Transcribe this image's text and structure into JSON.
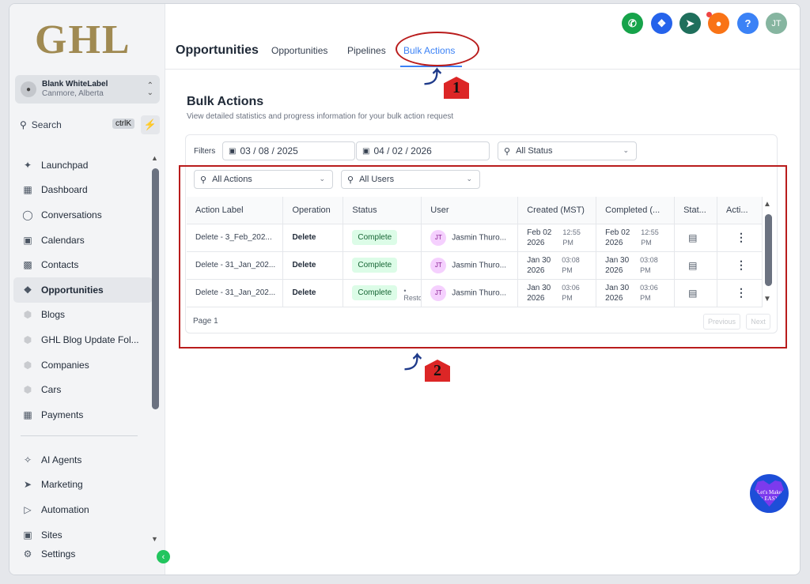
{
  "brand": {
    "logo_text": "GHL"
  },
  "account": {
    "name": "Blank WhiteLabel",
    "location": "Canmore, Alberta"
  },
  "search": {
    "placeholder": "Search",
    "shortcut": "ctrlK"
  },
  "sidebar": {
    "items": [
      {
        "label": "Launchpad",
        "icon": "rocket-icon"
      },
      {
        "label": "Dashboard",
        "icon": "dashboard-icon"
      },
      {
        "label": "Conversations",
        "icon": "chat-icon"
      },
      {
        "label": "Calendars",
        "icon": "calendar-icon"
      },
      {
        "label": "Contacts",
        "icon": "contacts-icon"
      },
      {
        "label": "Opportunities",
        "icon": "opportunities-icon",
        "active": true
      },
      {
        "label": "Blogs",
        "icon": "cube-icon"
      },
      {
        "label": "GHL Blog Update Fol...",
        "icon": "cube-icon"
      },
      {
        "label": "Companies",
        "icon": "cube-icon"
      },
      {
        "label": "Cars",
        "icon": "cube-icon"
      },
      {
        "label": "Payments",
        "icon": "payments-icon"
      }
    ],
    "bottom_items": [
      {
        "label": "AI Agents",
        "icon": "sparkle-icon"
      },
      {
        "label": "Marketing",
        "icon": "send-icon"
      },
      {
        "label": "Automation",
        "icon": "automation-icon"
      },
      {
        "label": "Sites",
        "icon": "sites-icon"
      },
      {
        "label": "Settings",
        "icon": "gear-icon"
      }
    ]
  },
  "header": {
    "page_title": "Opportunities",
    "tabs": [
      {
        "label": "Opportunities"
      },
      {
        "label": "Pipelines"
      },
      {
        "label": "Bulk Actions",
        "active": true
      }
    ],
    "user_initials": "JT",
    "help_label": "?"
  },
  "annotations": {
    "first": "1",
    "second": "2"
  },
  "main": {
    "title": "Bulk Actions",
    "subtitle": "View detailed statistics and progress information for your bulk action request"
  },
  "filters": {
    "label": "Filters",
    "date_from": "03 / 08 / 2025",
    "date_to": "04 / 02 / 2026",
    "status": "All Status",
    "actions": "All Actions",
    "users": "All Users"
  },
  "table": {
    "columns": [
      "Action Label",
      "Operation",
      "Status",
      "User",
      "Created (MST)",
      "Completed (...",
      "Stat...",
      "Acti..."
    ],
    "rows": [
      {
        "label": "Delete - 3_Feb_202...",
        "operation": "Delete",
        "status": "Complete",
        "user_initials": "JT",
        "user": "Jasmin Thuro...",
        "created_date": "Feb 02",
        "created_year": "2026",
        "created_time": "12:55",
        "created_ampm": "PM",
        "completed_date": "Feb 02",
        "completed_year": "2026",
        "completed_time": "12:55",
        "completed_ampm": "PM"
      },
      {
        "label": "Delete - 31_Jan_202...",
        "operation": "Delete",
        "status": "Complete",
        "user_initials": "JT",
        "user": "Jasmin Thuro...",
        "created_date": "Jan 30",
        "created_year": "2026",
        "created_time": "03:08",
        "created_ampm": "PM",
        "completed_date": "Jan 30",
        "completed_year": "2026",
        "completed_time": "03:08",
        "completed_ampm": "PM"
      },
      {
        "label": "Delete - 31_Jan_202...",
        "operation": "Delete",
        "status": "Complete",
        "status_extra": "Resto",
        "user_initials": "JT",
        "user": "Jasmin Thuro...",
        "created_date": "Jan 30",
        "created_year": "2026",
        "created_time": "03:06",
        "created_ampm": "PM",
        "completed_date": "Jan 30",
        "completed_year": "2026",
        "completed_time": "03:06",
        "completed_ampm": "PM"
      }
    ]
  },
  "pagination": {
    "page_label": "Page 1",
    "previous": "Previous",
    "next": "Next"
  },
  "helper": {
    "text": "Let's Make It EASY"
  },
  "colors": {
    "accent": "#3b82f6",
    "annotation": "#b91c1c",
    "complete": "#dcfce7"
  }
}
